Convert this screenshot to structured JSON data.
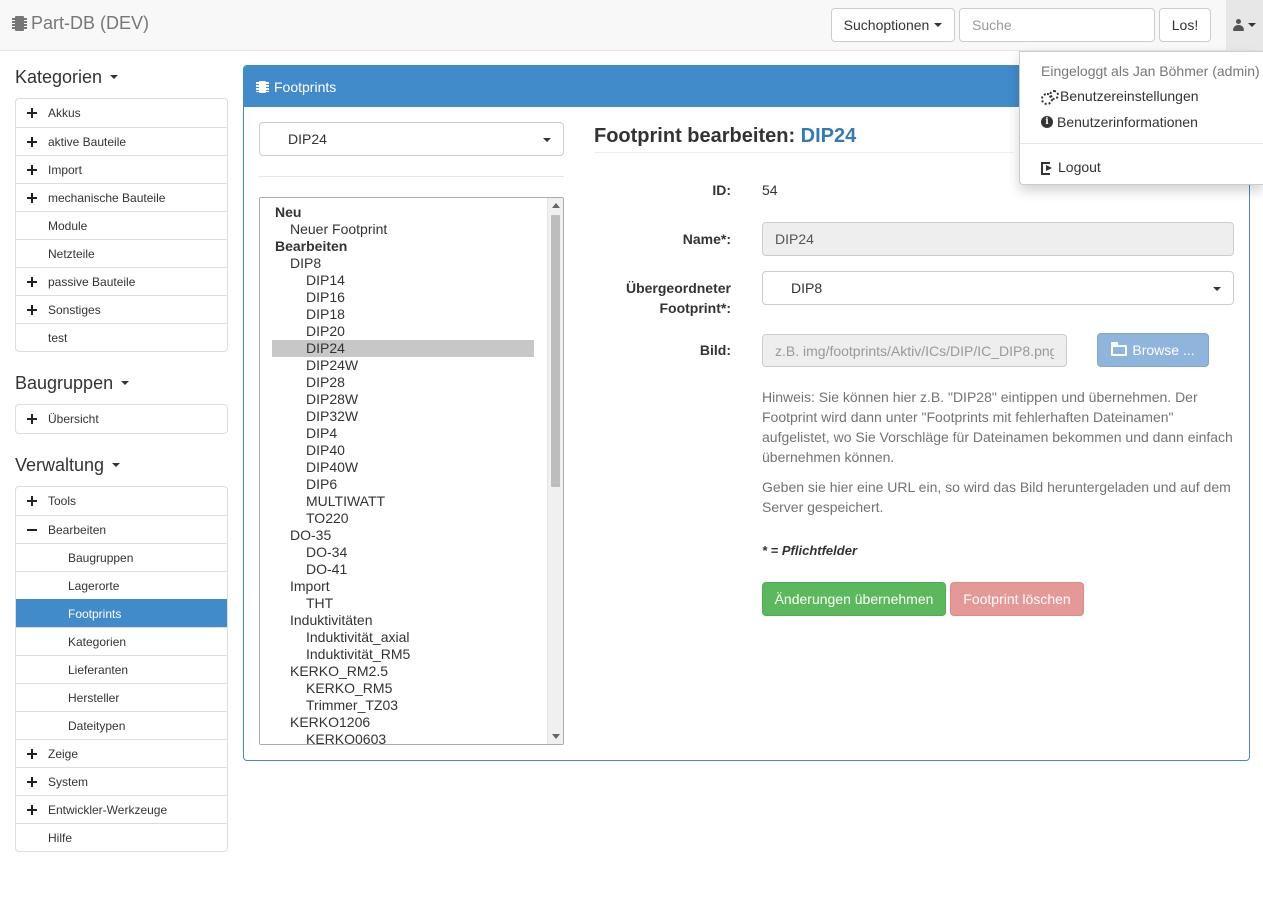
{
  "navbar": {
    "brand": "Part-DB (DEV)",
    "search_options_label": "Suchoptionen",
    "search_placeholder": "Suche",
    "search_button": "Los!"
  },
  "user_menu": {
    "header": "Eingeloggt als Jan Böhmer (admin)",
    "items": [
      "Benutzereinstellungen",
      "Benutzerinformationen"
    ],
    "logout": "Logout"
  },
  "sidebar": {
    "categories": {
      "title": "Kategorien",
      "items": [
        {
          "label": "Akkus",
          "icon": "plus-icon"
        },
        {
          "label": "aktive Bauteile",
          "icon": "plus-icon"
        },
        {
          "label": "Import",
          "icon": "plus-icon"
        },
        {
          "label": "mechanische Bauteile",
          "icon": "plus-icon"
        },
        {
          "label": "Module",
          "icon": ""
        },
        {
          "label": "Netzteile",
          "icon": ""
        },
        {
          "label": "passive Bauteile",
          "icon": "plus-icon"
        },
        {
          "label": "Sonstiges",
          "icon": "plus-icon"
        },
        {
          "label": "test",
          "icon": ""
        }
      ]
    },
    "assemblies": {
      "title": "Baugruppen",
      "items": [
        {
          "label": "Übersicht",
          "icon": "plus-icon"
        }
      ]
    },
    "admin": {
      "title": "Verwaltung",
      "items": [
        {
          "label": "Tools",
          "icon": "plus-icon"
        },
        {
          "label": "Bearbeiten",
          "icon": "minus-icon"
        },
        {
          "label": "Baugruppen",
          "sub": true
        },
        {
          "label": "Lagerorte",
          "sub": true
        },
        {
          "label": "Footprints",
          "sub": true,
          "active": true
        },
        {
          "label": "Kategorien",
          "sub": true
        },
        {
          "label": "Lieferanten",
          "sub": true
        },
        {
          "label": "Hersteller",
          "sub": true
        },
        {
          "label": "Dateitypen",
          "sub": true
        },
        {
          "label": "Zeige",
          "icon": "plus-icon"
        },
        {
          "label": "System",
          "icon": "plus-icon"
        },
        {
          "label": "Entwickler-Werkzeuge",
          "icon": "plus-icon"
        },
        {
          "label": "Hilfe",
          "icon": ""
        }
      ]
    }
  },
  "panel": {
    "title": "Footprints",
    "selected_footprint": "DIP24",
    "tree": [
      {
        "label": "Neu",
        "level": 0
      },
      {
        "label": "Neuer Footprint",
        "level": 1
      },
      {
        "label": "Bearbeiten",
        "level": 0
      },
      {
        "label": "DIP8",
        "level": 1
      },
      {
        "label": "DIP14",
        "level": 2
      },
      {
        "label": "DIP16",
        "level": 2
      },
      {
        "label": "DIP18",
        "level": 2
      },
      {
        "label": "DIP20",
        "level": 2
      },
      {
        "label": "DIP24",
        "level": 2,
        "selected": true
      },
      {
        "label": "DIP24W",
        "level": 2
      },
      {
        "label": "DIP28",
        "level": 2
      },
      {
        "label": "DIP28W",
        "level": 2
      },
      {
        "label": "DIP32W",
        "level": 2
      },
      {
        "label": "DIP4",
        "level": 2
      },
      {
        "label": "DIP40",
        "level": 2
      },
      {
        "label": "DIP40W",
        "level": 2
      },
      {
        "label": "DIP6",
        "level": 2
      },
      {
        "label": "MULTIWATT",
        "level": 2
      },
      {
        "label": "TO220",
        "level": 2
      },
      {
        "label": "DO-35",
        "level": 1
      },
      {
        "label": "DO-34",
        "level": 2
      },
      {
        "label": "DO-41",
        "level": 2
      },
      {
        "label": "Import",
        "level": 1
      },
      {
        "label": "THT",
        "level": 2
      },
      {
        "label": "Induktivitäten",
        "level": 1
      },
      {
        "label": "Induktivität_axial",
        "level": 2
      },
      {
        "label": "Induktivität_RM5",
        "level": 2
      },
      {
        "label": "KERKO_RM2.5",
        "level": 1
      },
      {
        "label": "KERKO_RM5",
        "level": 2
      },
      {
        "label": "Trimmer_TZ03",
        "level": 2
      },
      {
        "label": "KERKO1206",
        "level": 1
      },
      {
        "label": "KERKO0603",
        "level": 2
      }
    ]
  },
  "form": {
    "title_prefix": "Footprint bearbeiten: ",
    "title_name": "DIP24",
    "id_label": "ID:",
    "id_value": "54",
    "name_label": "Name*:",
    "name_value": "DIP24",
    "parent_label_1": "Übergeordneter",
    "parent_label_2": "Footprint*:",
    "parent_value": "DIP8",
    "image_label": "Bild:",
    "image_placeholder": "z.B. img/footprints/Aktiv/ICs/DIP/IC_DIP8.png",
    "browse_button": "Browse ...",
    "hint_1": "Hinweis: Sie können hier z.B. \"DIP28\" eintippen und übernehmen. Der Footprint wird dann unter \"Footprints mit fehlerhaften Dateinamen\" aufgelistet, wo Sie Vorschläge für Dateinamen bekommen und dann einfach übernehmen können.",
    "hint_2": "Geben sie hier eine URL ein, so wird das Bild heruntergeladen und auf dem Server gespeichert.",
    "required_note": "* = Pflichtfelder",
    "save_button": "Änderungen übernehmen",
    "delete_button": "Footprint löschen"
  },
  "colors": {
    "primary": "#428bca",
    "success": "#5cb85c",
    "danger_disabled": "#e49996",
    "browse_disabled": "#8fb5dc"
  }
}
